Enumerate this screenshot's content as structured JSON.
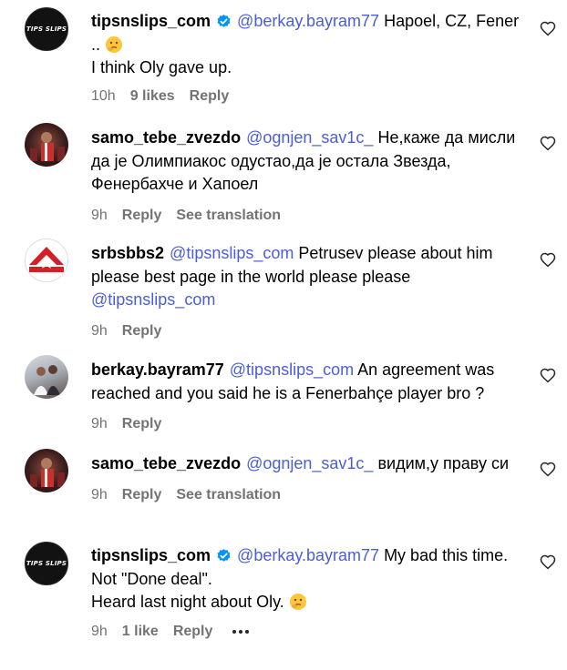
{
  "comments": [
    {
      "username": "tipsnslips_com",
      "verified": true,
      "avatar": "tipsnslips-logo",
      "avatar_text": "TIPS SLIPS",
      "mention": "@berkay.bayram77",
      "lines_text": " Hapoel, CZ, Fener .. ",
      "line2": "I think Oly gave up.",
      "time": "10h",
      "likes": "9 likes",
      "reply": "Reply"
    },
    {
      "username": "samo_tebe_zvezdo",
      "avatar": "player-photo",
      "mention": "@ognjen_sav1c_",
      "text": " Не,каже да мисли да је Олимпиакос одустао,да је остала Звезда, Фенербахче и Хапоел",
      "time": "9h",
      "reply": "Reply",
      "translate": "See translation"
    },
    {
      "username": "srbsbbs2",
      "avatar": "red-star-flag",
      "mention": "@tipsnslips_com",
      "text": " Petrusev please about him please best page in the world please please ",
      "mention2": "@tipsnslips_com",
      "time": "9h",
      "reply": "Reply"
    },
    {
      "username": "berkay.bayram77",
      "avatar": "couple-photo",
      "mention": "@tipsnslips_com",
      "text": " An agreement was reached and you said he is a Fenerbahçe player bro ?",
      "time": "9h",
      "reply": "Reply"
    },
    {
      "username": "samo_tebe_zvezdo",
      "avatar": "player-photo",
      "mention": "@ognjen_sav1c_",
      "text": " видим,у праву си",
      "time": "9h",
      "reply": "Reply",
      "translate": "See translation"
    },
    {
      "username": "tipsnslips_com",
      "verified": true,
      "avatar": "tipsnslips-logo",
      "avatar_text": "TIPS SLIPS",
      "mention": "@berkay.bayram77",
      "text": " My bad this time.",
      "line2": "Not \"Done deal\".",
      "line3": "Heard last night about Oly. ",
      "time": "9h",
      "likes": "1 like",
      "reply": "Reply"
    }
  ],
  "icons": {
    "like": "heart-outline-icon",
    "verified": "verified-badge-icon",
    "emoji": "thinking-face-emoji",
    "more": "more-options-icon"
  },
  "colors": {
    "mention": "#4a5ed8",
    "meta": "#737373",
    "verified": "#0095f6"
  }
}
